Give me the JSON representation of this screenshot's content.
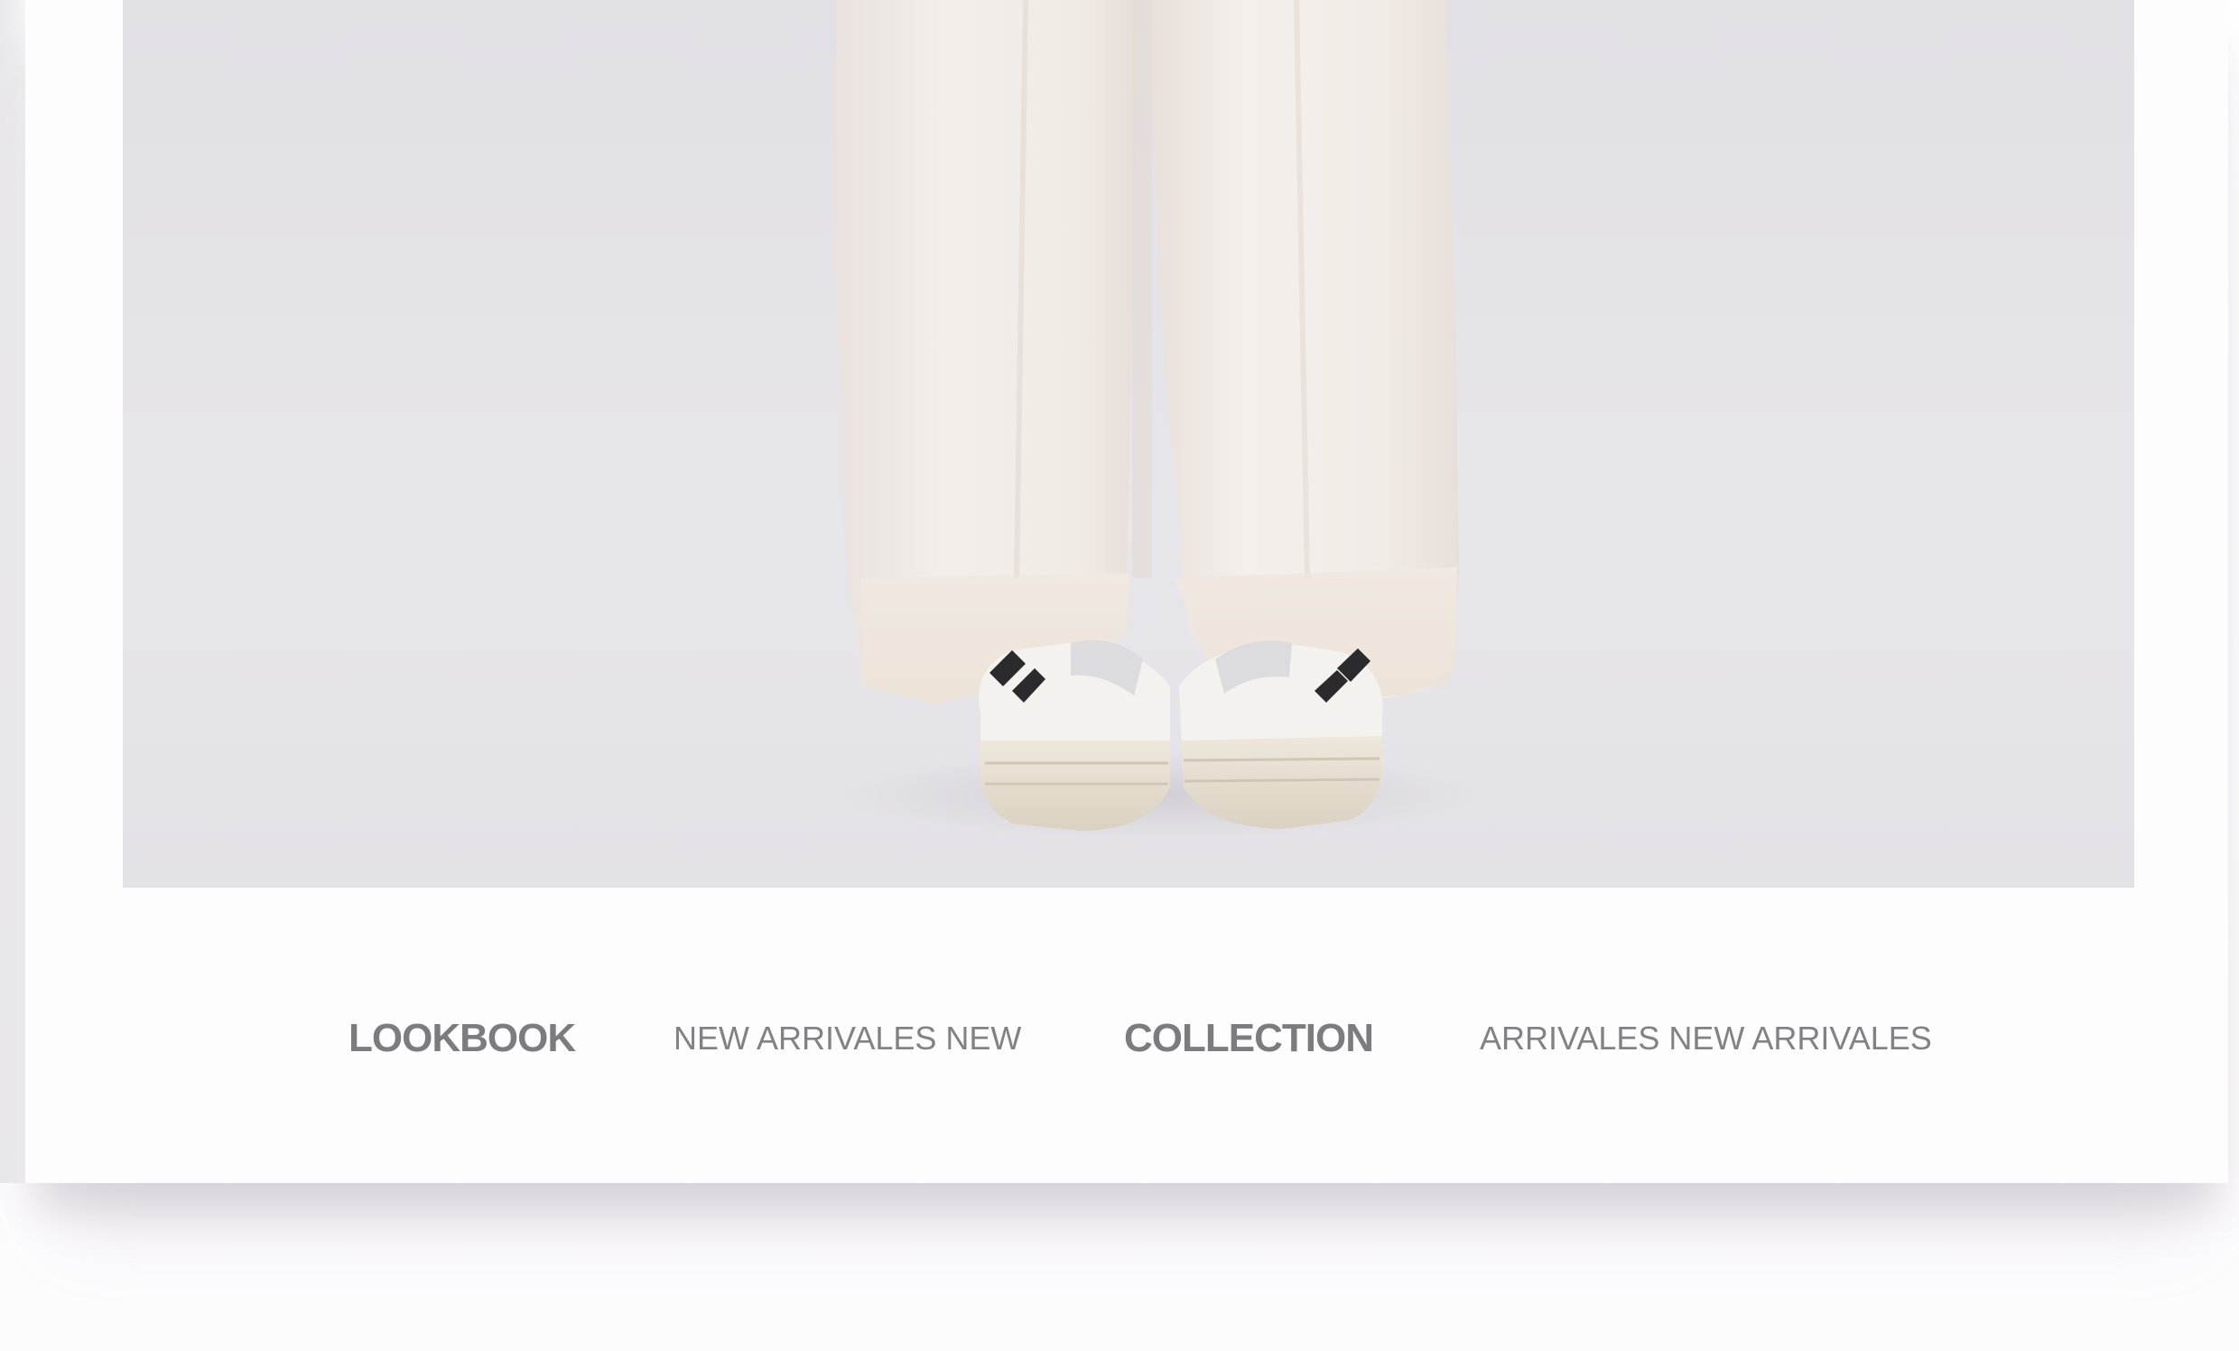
{
  "nav": {
    "items": [
      {
        "label": "LOOKBOOK",
        "emphasis": "bold"
      },
      {
        "label": "NEW ARRIVALES NEW",
        "emphasis": "regular"
      },
      {
        "label": "COLLECTION",
        "emphasis": "bold"
      },
      {
        "label": "ARRIVALES NEW ARRIVALES",
        "emphasis": "regular"
      }
    ]
  },
  "colors": {
    "background": "#fefdfe",
    "photo_backdrop": "#e4e3e8",
    "trousers": "#f1ebe6",
    "nav_text": "#7a7a7c"
  },
  "icons": {
    "photo": "model-trousers-sneakers-image"
  }
}
